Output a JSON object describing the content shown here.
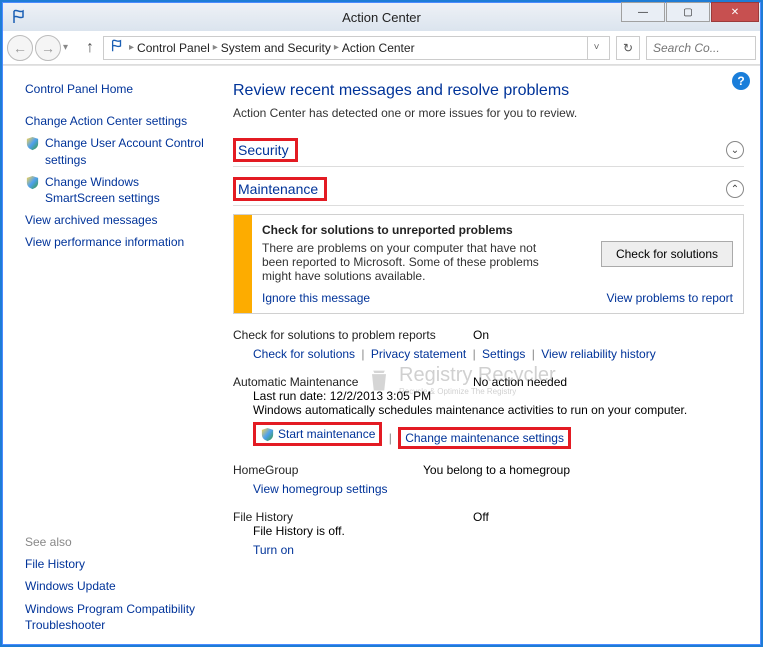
{
  "window": {
    "title": "Action Center",
    "minimize": "—",
    "maximize": "▢",
    "close": "✕"
  },
  "breadcrumb": {
    "items": [
      "Control Panel",
      "System and Security",
      "Action Center"
    ]
  },
  "search": {
    "placeholder": "Search Co..."
  },
  "sidebar": {
    "home": "Control Panel Home",
    "links": [
      "Change Action Center settings",
      "Change User Account Control settings",
      "Change Windows SmartScreen settings",
      "View archived messages",
      "View performance information"
    ],
    "see_also_head": "See also",
    "see_also": [
      "File History",
      "Windows Update",
      "Windows Program Compatibility Troubleshooter"
    ]
  },
  "main": {
    "heading": "Review recent messages and resolve problems",
    "subtext": "Action Center has detected one or more issues for you to review.",
    "sections": {
      "security": "Security",
      "maintenance": "Maintenance"
    },
    "notice": {
      "title": "Check for solutions to unreported problems",
      "text": "There are problems on your computer that have not been reported to Microsoft. Some of these problems might have solutions available.",
      "button": "Check for solutions",
      "ignore": "Ignore this message",
      "view_problems": "View problems to report"
    },
    "solutions_row": {
      "label": "Check for solutions to problem reports",
      "status": "On"
    },
    "solutions_links": [
      "Check for solutions",
      "Privacy statement",
      "Settings",
      "View reliability history"
    ],
    "auto_maint": {
      "label": "Automatic Maintenance",
      "status": "No action needed",
      "last_run": "Last run date: 12/2/2013 3:05 PM",
      "desc": "Windows automatically schedules maintenance activities to run on your computer.",
      "start": "Start maintenance",
      "change": "Change maintenance settings"
    },
    "homegroup": {
      "label": "HomeGroup",
      "status": "You belong to a homegroup",
      "link": "View homegroup settings"
    },
    "filehistory": {
      "label": "File History",
      "status": "Off",
      "desc": "File History is off.",
      "link": "Turn on"
    }
  },
  "watermark": {
    "main": "Registry Recycler",
    "sub": "Recycle & Optimize The Registry"
  }
}
